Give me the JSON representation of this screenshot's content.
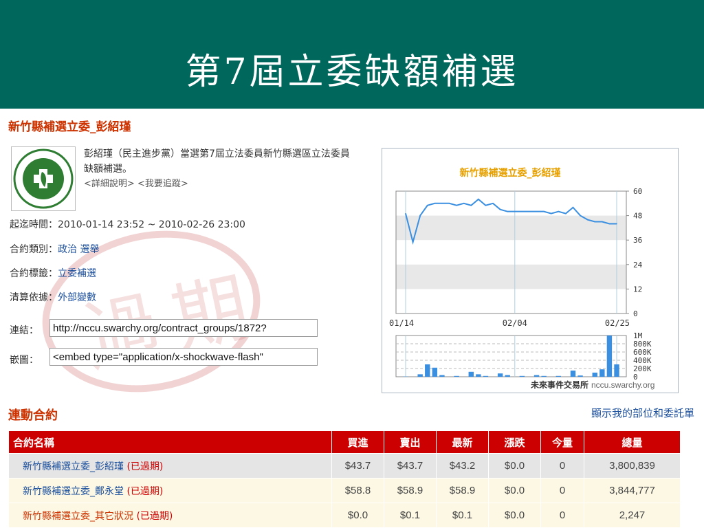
{
  "slide": {
    "title": "第7屆立委缺額補選"
  },
  "contract": {
    "heading": "新竹縣補選立委_彭紹瑾",
    "description": "彭紹瑾（民主進步黨）當選第7屆立法委員新竹縣選區立法委員缺額補選。",
    "link_detail": "<詳細說明>",
    "link_follow": "<我要追蹤>",
    "time_label": "起迄時間：",
    "time_value": "2010-01-14 23:52 ~ 2010-02-26 23:00",
    "category_label": "合約類別：",
    "category_value": "政治 選舉",
    "tag_label": "合約標籤：",
    "tag_value": "立委補選",
    "settle_label": "清算依據：",
    "settle_value": "外部變數",
    "url_label": "連結：",
    "url_value": "http://nccu.swarchy.org/contract_groups/1872?",
    "embed_label": "嵌圖：",
    "embed_value": "<embed type=\"application/x-shockwave-flash\""
  },
  "chart_data": {
    "type": "line",
    "title": "新竹縣補選立委_彭紹瑾",
    "x_tick_labels": [
      "01/14",
      "02/04",
      "02/25"
    ],
    "y_tick_labels": [
      "60",
      "48",
      "36",
      "24",
      "12",
      "0"
    ],
    "ylim": [
      0,
      60
    ],
    "price_series": [
      49,
      35,
      48,
      53,
      54,
      54,
      54,
      53,
      54,
      53,
      56,
      53,
      54,
      51,
      50,
      50,
      50,
      50,
      50,
      50,
      49,
      50,
      49,
      52,
      48,
      46,
      45,
      45,
      44,
      44
    ],
    "volume_tick_labels": [
      "1M",
      "800K",
      "600K",
      "400K",
      "200K",
      "0"
    ],
    "volume_ylim": [
      0,
      1000000
    ],
    "volume_series": [
      5000,
      0,
      60000,
      300000,
      220000,
      40000,
      0,
      20000,
      0,
      120000,
      60000,
      20000,
      0,
      80000,
      40000,
      0,
      20000,
      0,
      40000,
      20000,
      0,
      20000,
      0,
      150000,
      30000,
      0,
      100000,
      180000,
      1000000,
      300000
    ],
    "grid": true,
    "footer_brand": "未來事件交易所",
    "footer_site": "nccu.swarchy.org",
    "line_color": "#3b8fe0",
    "bar_color": "#3b8fe0"
  },
  "section": {
    "title": "連動合約",
    "show_link": "顯示我的部位和委託單"
  },
  "table": {
    "headers": [
      "合約名稱",
      "買進",
      "賣出",
      "最新",
      "漲跌",
      "今量",
      "總量"
    ],
    "rows": [
      {
        "name": "新竹縣補選立委_彭紹瑾",
        "status": "(已過期)",
        "buy": "$43.7",
        "sell": "$43.7",
        "last": "$43.2",
        "change": "$0.0",
        "today": "0",
        "total": "3,800,839"
      },
      {
        "name": "新竹縣補選立委_鄭永堂",
        "status": "(已過期)",
        "buy": "$58.8",
        "sell": "$58.9",
        "last": "$58.9",
        "change": "$0.0",
        "today": "0",
        "total": "3,844,777"
      },
      {
        "name": "新竹縣補選立委_其它狀況",
        "status": "(已過期)",
        "buy": "$0.0",
        "sell": "$0.1",
        "last": "$0.1",
        "change": "$0.0",
        "today": "0",
        "total": "2,247"
      }
    ]
  },
  "colors": {
    "title_bar": "#00675d",
    "accent_red": "#cc0000",
    "heading_orange": "#cc3300",
    "link_blue": "#1b4f9c"
  }
}
